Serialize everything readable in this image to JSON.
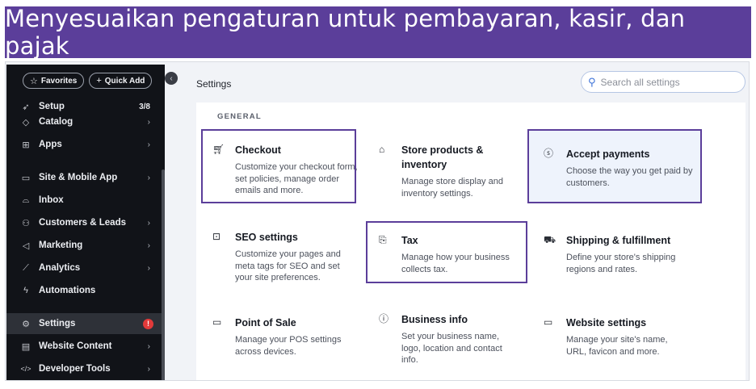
{
  "banner": {
    "title": "Menyesuaikan pengaturan untuk pembayaran, kasir, dan pajak"
  },
  "sidebar": {
    "favorites_label": "Favorites",
    "quick_add_label": "Quick Add",
    "items": [
      {
        "label": "Setup",
        "icon": "rocket-icon",
        "right": "3/8"
      },
      {
        "label": "Catalog",
        "icon": "catalog-icon",
        "right": "›"
      },
      {
        "label": "Apps",
        "icon": "apps-icon",
        "right": "›"
      },
      {
        "label": "Site & Mobile App",
        "icon": "site-icon",
        "right": "›"
      },
      {
        "label": "Inbox",
        "icon": "inbox-icon",
        "right": ""
      },
      {
        "label": "Customers & Leads",
        "icon": "people-icon",
        "right": "›"
      },
      {
        "label": "Marketing",
        "icon": "megaphone-icon",
        "right": "›"
      },
      {
        "label": "Analytics",
        "icon": "chart-icon",
        "right": "›"
      },
      {
        "label": "Automations",
        "icon": "bolt-icon",
        "right": ""
      },
      {
        "label": "Settings",
        "icon": "gear-icon",
        "right": "!"
      },
      {
        "label": "Website Content",
        "icon": "content-icon",
        "right": "›"
      },
      {
        "label": "Developer Tools",
        "icon": "code-icon",
        "right": "›"
      }
    ]
  },
  "main": {
    "heading": "Settings",
    "search_placeholder": "Search all settings",
    "section": "GENERAL",
    "cards": [
      {
        "title": "Checkout",
        "desc": "Customize your checkout form, set policies, manage order emails and more.",
        "icon": "cart-icon"
      },
      {
        "title": "Store products & inventory",
        "desc": "Manage store display and inventory settings.",
        "icon": "store-icon"
      },
      {
        "title": "Accept payments",
        "desc": "Choose the way you get paid by customers.",
        "icon": "dollar-icon"
      },
      {
        "title": "SEO settings",
        "desc": "Customize your pages and meta tags for SEO and set your site preferences.",
        "icon": "seo-icon"
      },
      {
        "title": "Tax",
        "desc": "Manage how your business collects tax.",
        "icon": "receipt-icon"
      },
      {
        "title": "Shipping & fulfillment",
        "desc": "Define your store's shipping regions and rates.",
        "icon": "truck-icon"
      },
      {
        "title": "Point of Sale",
        "desc": "Manage your POS settings across devices.",
        "icon": "pos-icon"
      },
      {
        "title": "Business info",
        "desc": "Set your business name, logo, location and contact info.",
        "icon": "info-icon"
      },
      {
        "title": "Website settings",
        "desc": "Manage your site's name, URL, favicon and more.",
        "icon": "browser-icon"
      }
    ]
  },
  "colors": {
    "highlight": "#5b3e9a",
    "sidebar_bg": "#111318",
    "accent": "#3f74d8",
    "alert": "#e23a3a"
  }
}
